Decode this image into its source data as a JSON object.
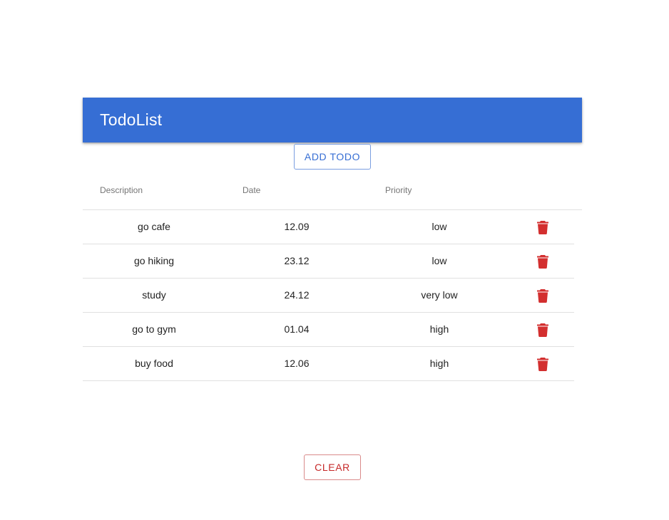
{
  "app_bar": {
    "title": "TodoList",
    "color": "#366ed4"
  },
  "toolbar": {
    "add_label": "ADD TODO",
    "clear_label": "CLEAR"
  },
  "table": {
    "columns": [
      "Description",
      "Date",
      "Priority"
    ],
    "rows": [
      {
        "description": "go cafe",
        "date": "12.09",
        "priority": "low"
      },
      {
        "description": "go hiking",
        "date": "23.12",
        "priority": "low"
      },
      {
        "description": "study",
        "date": "24.12",
        "priority": "very low"
      },
      {
        "description": "go to gym",
        "date": "01.04",
        "priority": "high"
      },
      {
        "description": "buy food",
        "date": "12.06",
        "priority": "high"
      }
    ],
    "delete_icon": "trash-icon",
    "delete_color": "#d32f2f"
  }
}
